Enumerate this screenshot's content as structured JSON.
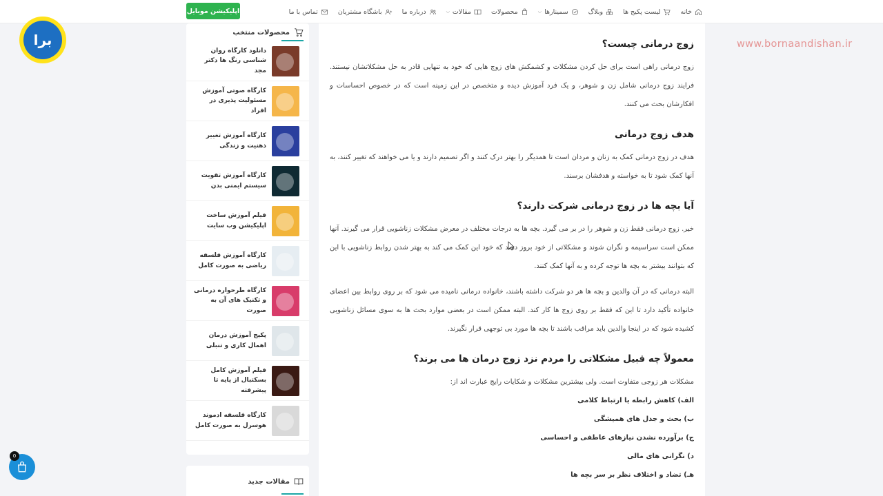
{
  "nav": {
    "items": [
      {
        "label": "خانه",
        "icon": "home-icon"
      },
      {
        "label": "لیست پکیج ها",
        "icon": "cart-icon"
      },
      {
        "label": "وبلاگ",
        "icon": "boxes-icon"
      },
      {
        "label": "سمینارها",
        "icon": "badge-icon",
        "dropdown": true
      },
      {
        "label": "محصولات",
        "icon": "bag-icon"
      },
      {
        "label": "مقالات",
        "icon": "book-icon",
        "dropdown": true
      },
      {
        "label": "درباره ما",
        "icon": "users-icon"
      },
      {
        "label": "باشگاه مشتریان",
        "icon": "user-plus-icon"
      },
      {
        "label": "تماس با ما",
        "icon": "mail-icon"
      }
    ],
    "app_button": "اپلیکیشن موبایل"
  },
  "logo": {
    "text": "برا"
  },
  "watermark": "www.bornaandishan.ir",
  "sidebar": {
    "title": "محصولات منتخب",
    "products": [
      {
        "title": "دانلود کارگاه روان شناسی رنگ ها دکتر مجد",
        "color": "#7a3b2a"
      },
      {
        "title": "کارگاه صوتی آموزش مسئولیت پذیری در افراد",
        "color": "#f5b64a"
      },
      {
        "title": "کارگاه آموزش تغییر ذهنیت و زندگی",
        "color": "#2a3f9e"
      },
      {
        "title": "کارگاه آموزش تقویت سیستم ایمنی بدن",
        "color": "#0f2a33"
      },
      {
        "title": "فیلم آموزش ساخت اپلیکیشن وب سایت",
        "color": "#f2b43a"
      },
      {
        "title": "کارگاه آموزش فلسفه ریاضی به صورت کامل",
        "color": "#e6edf2"
      },
      {
        "title": "کارگاه طرحواره درمانی و تکنیک های آن به صورت",
        "color": "#d83c6a"
      },
      {
        "title": "پکیج آموزش درمان اهمال کاری و تنبلی",
        "color": "#dfe6ea"
      },
      {
        "title": "فیلم آموزش کامل بسکتبال از پایه تا پیشرفته",
        "color": "#3a1a14"
      },
      {
        "title": "کارگاه فلسفه ادموند هوسرل به صورت کامل",
        "color": "#d9d9d9"
      }
    ],
    "articles_title": "مقالات جدید"
  },
  "content": {
    "h1": "زوج درمانی چیست؟",
    "p1": "زوج درمانی راهی است برای حل کردن مشکلات و کشمکش های زوج هایی که خود به تنهایی قادر به حل مشکلاتشان نیستند. فرایند زوج درمانی شامل زن و شوهر، و یک فرد آموزش دیده و متخصص در این زمینه است که در خصوص احساسات و افکارشان بحث می کنند.",
    "h2": "هدف زوج درمانی",
    "p2": "هدف در زوج درمانی کمک به زنان و مردان است تا همدیگر را بهتر درک کنند و اگر تصمیم دارند و یا می خواهند که تغییر کنند، به آنها کمک شود تا به خواسته و هدفشان برسند.",
    "h3": "آیا بچه ها در زوج درمانی شرکت دارند؟",
    "p3": "خیر. زوج درمانی فقط زن و شوهر را در بر می گیرد. بچه ها به درجات مختلف در معرض مشکلات زناشویی  قرار می گیرند. آنها ممکن است سراسیمه و نگران شوند و مشکلاتی از خود بروز دهند که خود این کمک می کند به بهتر شدن روابط زناشویی با این که بتوانند بیشتر به بچه ها توجه کرده و به آنها کمک کنند.",
    "p4": "البته درمانی که در آن والدین و بچه ها هر دو شرکت داشته باشند، خانواده درمانی نامیده می شود که بر روی روابط بین اعضای خانواده تأکید دارد تا این که فقط بر روی زوج ها کار کند. البته ممکن است در بعضی موارد بحث ها به سوی مسائل زناشویی کشیده شود که در اینجا والدین باید مراقب باشند تا بچه ها مورد بی توجهی قرار نگیرند.",
    "h4": "معمولاً چه قبیل مشکلاتی را مردم نزد زوج درمان ها می برند؟",
    "p5": "مشکلات هر زوجی متفاوت است. ولی بیشترین مشکلات و شکایات رایج عبارت اند از:",
    "list": [
      "الف) کاهش رابطه یا ارتباط کلامی",
      "ب) بحث و جدل های همیشگی",
      "ج) برآورده نشدن نیازهای عاطفی و احساسی",
      "د) نگرانی های مالی",
      "هـ) تضاد و اختلاف نظر بر سر بچه ها"
    ]
  },
  "cart": {
    "count": "0"
  }
}
